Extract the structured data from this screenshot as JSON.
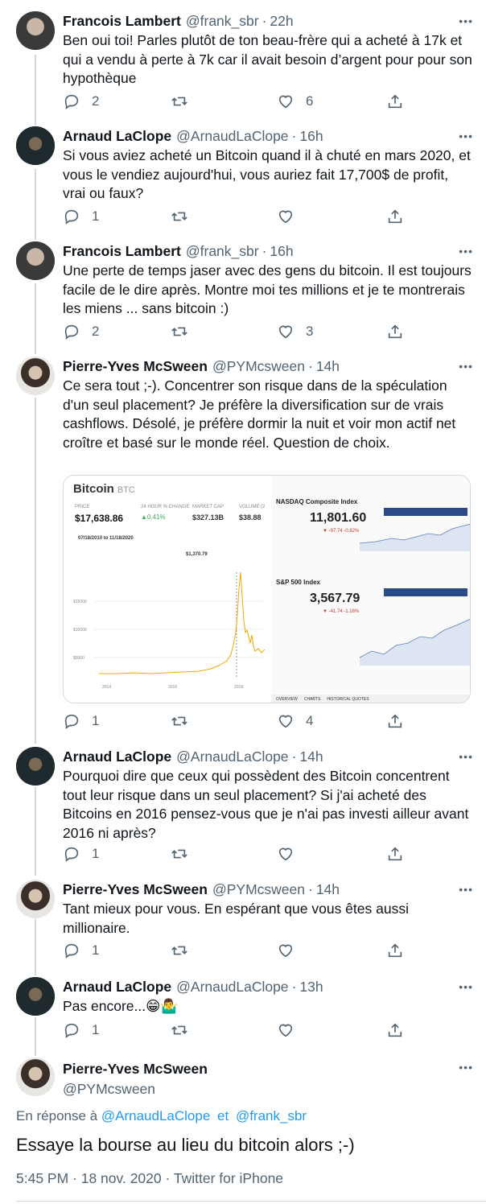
{
  "tweets": [
    {
      "name": "Francois Lambert",
      "handle": "@frank_sbr",
      "time": "22h",
      "text": "Ben oui toi! Parles plutôt de ton beau-frère qui a acheté à 17k et qui a vendu à perte à 7k car il avait besoin d’argent pour pour son hypothèque",
      "replies": "2",
      "retweets": "",
      "likes": "6"
    },
    {
      "name": "Arnaud LaClope",
      "handle": "@ArnaudLaClope",
      "time": "16h",
      "text": "Si vous aviez acheté un Bitcoin quand il à chuté en mars 2020, et vous le vendiez aujourd'hui, vous auriez fait 17,700$ de profit, vrai ou faux?",
      "replies": "1",
      "retweets": "",
      "likes": ""
    },
    {
      "name": "Francois Lambert",
      "handle": "@frank_sbr",
      "time": "16h",
      "text": "Une perte de temps jaser avec des gens du bitcoin. Il est toujours facile de le dire après. Montre moi tes millions et je te montrerais les miens ... sans bitcoin :)",
      "replies": "2",
      "retweets": "",
      "likes": "3"
    },
    {
      "name": "Pierre-Yves McSween",
      "handle": "@PYMcsween",
      "time": "14h",
      "text": "Ce sera tout ;-). Concentrer son risque dans de la spéculation d'un seul placement? Je préfère la diversification sur de vrais cashflows. Désolé, je préfère dormir la nuit et voir mon actif net croître et basé sur le monde réel. Question de choix.",
      "replies": "1",
      "retweets": "",
      "likes": "4"
    },
    {
      "name": "Arnaud LaClope",
      "handle": "@ArnaudLaClope",
      "time": "14h",
      "text": "Pourquoi dire que ceux qui possèdent des Bitcoin concentrent tout leur risque dans un seul placement? Si j'ai acheté des Bitcoins en 2016 pensez-vous que je n'ai pas investi ailleur avant 2016 ni après?",
      "replies": "1",
      "retweets": "",
      "likes": ""
    },
    {
      "name": "Pierre-Yves McSween",
      "handle": "@PYMcsween",
      "time": "14h",
      "text": "Tant mieux pour vous. En espérant que vous êtes aussi millionaire.",
      "replies": "1",
      "retweets": "",
      "likes": ""
    },
    {
      "name": "Arnaud LaClope",
      "handle": "@ArnaudLaClope",
      "time": "13h",
      "text": "Pas encore...😁🤷‍♂️",
      "replies": "1",
      "retweets": "",
      "likes": ""
    }
  ],
  "media": {
    "btc_title": "Bitcoin",
    "btc_symbol": "BTC",
    "btc_price": "$17,638.86",
    "btc_change": "▲0.41%",
    "btc_market_cap": "$327.13B",
    "btc_volume": "$38.88",
    "btc_price_label": "PRICE",
    "btc_change_label": "24 HOUR % CHANGE",
    "btc_cap_label": "MARKET CAP",
    "btc_vol_label": "VOLUME (2",
    "btc_date_range": "07/18/2010  to  11/18/2020",
    "btc_tooltip": "$1,370.79",
    "btc_y_labels": [
      "$15000",
      "$10000",
      "$5000"
    ],
    "btc_x_labels": [
      "2014",
      "2016",
      "2018"
    ],
    "nasdaq_title": "NASDAQ Composite Index",
    "nasdaq_value": "11,801.60",
    "nasdaq_change": "▼ -97.74 -0.82%",
    "sp_title": "S&P 500 Index",
    "sp_value": "3,567.79",
    "sp_change": "▼ -41.74 -1.16%",
    "tabs": [
      "OVERVIEW",
      "CHARTS",
      "HISTORICAL QUOTES"
    ]
  },
  "focused": {
    "name": "Pierre-Yves McSween",
    "handle": "@PYMcsween",
    "reply_prefix": "En réponse à",
    "reply_user1": "@ArnaudLaClope",
    "reply_and": "et",
    "reply_user2": "@frank_sbr",
    "text": "Essaye la bourse au lieu du bitcoin alors ;-)",
    "meta": "5:45 PM · 18 nov. 2020 · Twitter for iPhone"
  },
  "icons": {
    "reply": "reply-icon",
    "retweet": "retweet-icon",
    "like": "heart-icon",
    "share": "share-icon",
    "more": "more-icon"
  },
  "colors": {
    "link": "#1d9bf0",
    "secondary": "#536471",
    "line": "#cfd9de",
    "bitcoin_line": "#f2a900"
  }
}
